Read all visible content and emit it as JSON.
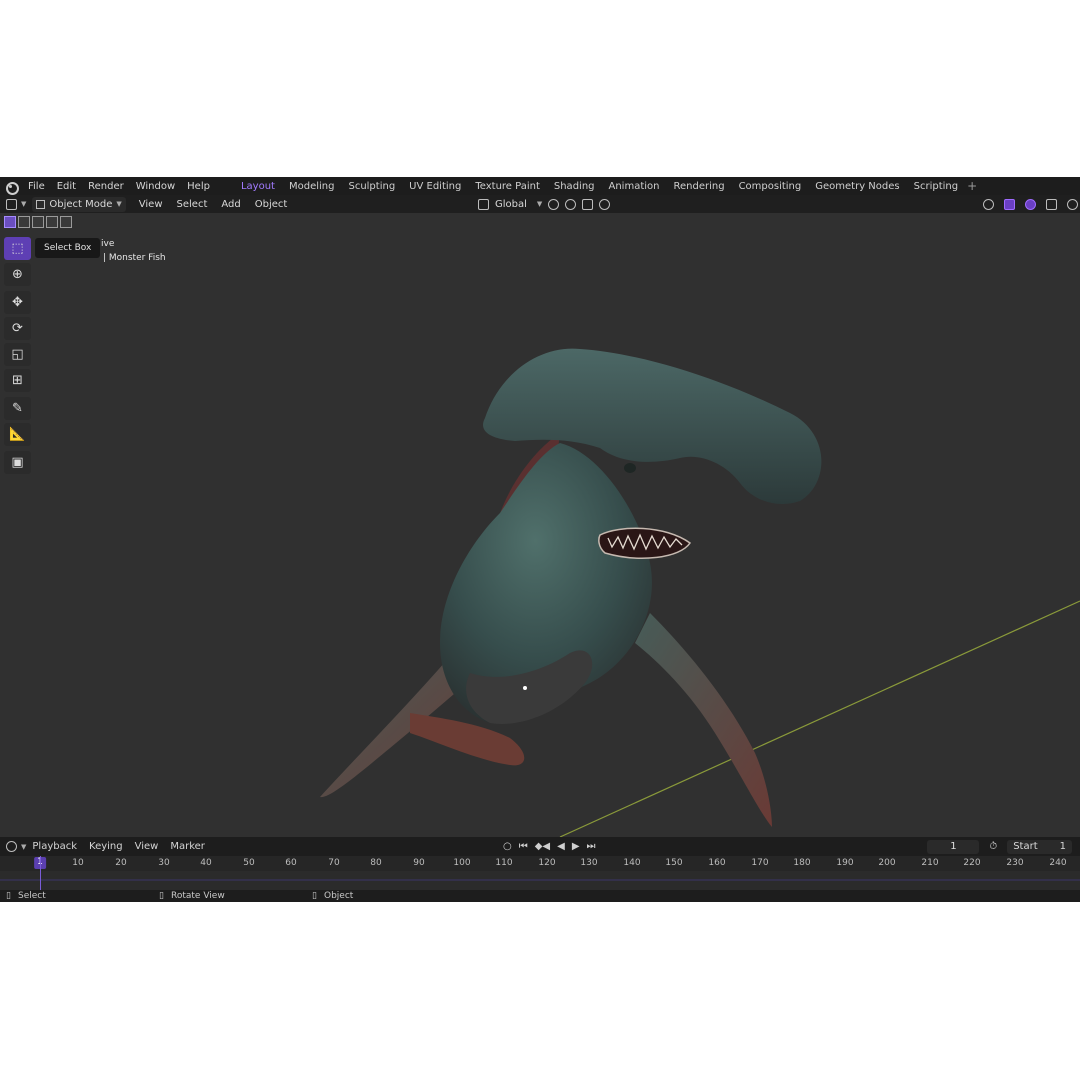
{
  "app": {
    "menu": [
      "File",
      "Edit",
      "Render",
      "Window",
      "Help"
    ],
    "workspaces": [
      "Layout",
      "Modeling",
      "Sculpting",
      "UV Editing",
      "Texture Paint",
      "Shading",
      "Animation",
      "Rendering",
      "Compositing",
      "Geometry Nodes",
      "Scripting"
    ],
    "active_workspace": "Layout",
    "add_workspace": "+"
  },
  "header": {
    "mode": "Object Mode",
    "menus": [
      "View",
      "Select",
      "Add",
      "Object"
    ],
    "transform_orientation": "Global"
  },
  "viewport": {
    "tooltip": "Select Box",
    "overlay_line1": "ive",
    "overlay_line2": "| Monster Fish",
    "accent": "#6b4fc0"
  },
  "timeline": {
    "menus": [
      "Playback",
      "Keying",
      "View",
      "Marker"
    ],
    "current_frame": "1",
    "start_label": "Start",
    "start_value": "1",
    "ticks": [
      "10",
      "20",
      "30",
      "40",
      "50",
      "60",
      "70",
      "80",
      "90",
      "100",
      "110",
      "120",
      "130",
      "140",
      "150",
      "160",
      "170",
      "180",
      "190",
      "200",
      "210",
      "220",
      "230",
      "240"
    ],
    "cursor_frame": "1"
  },
  "statusbar": {
    "select": "Select",
    "rotate": "Rotate View",
    "object": "Object"
  }
}
